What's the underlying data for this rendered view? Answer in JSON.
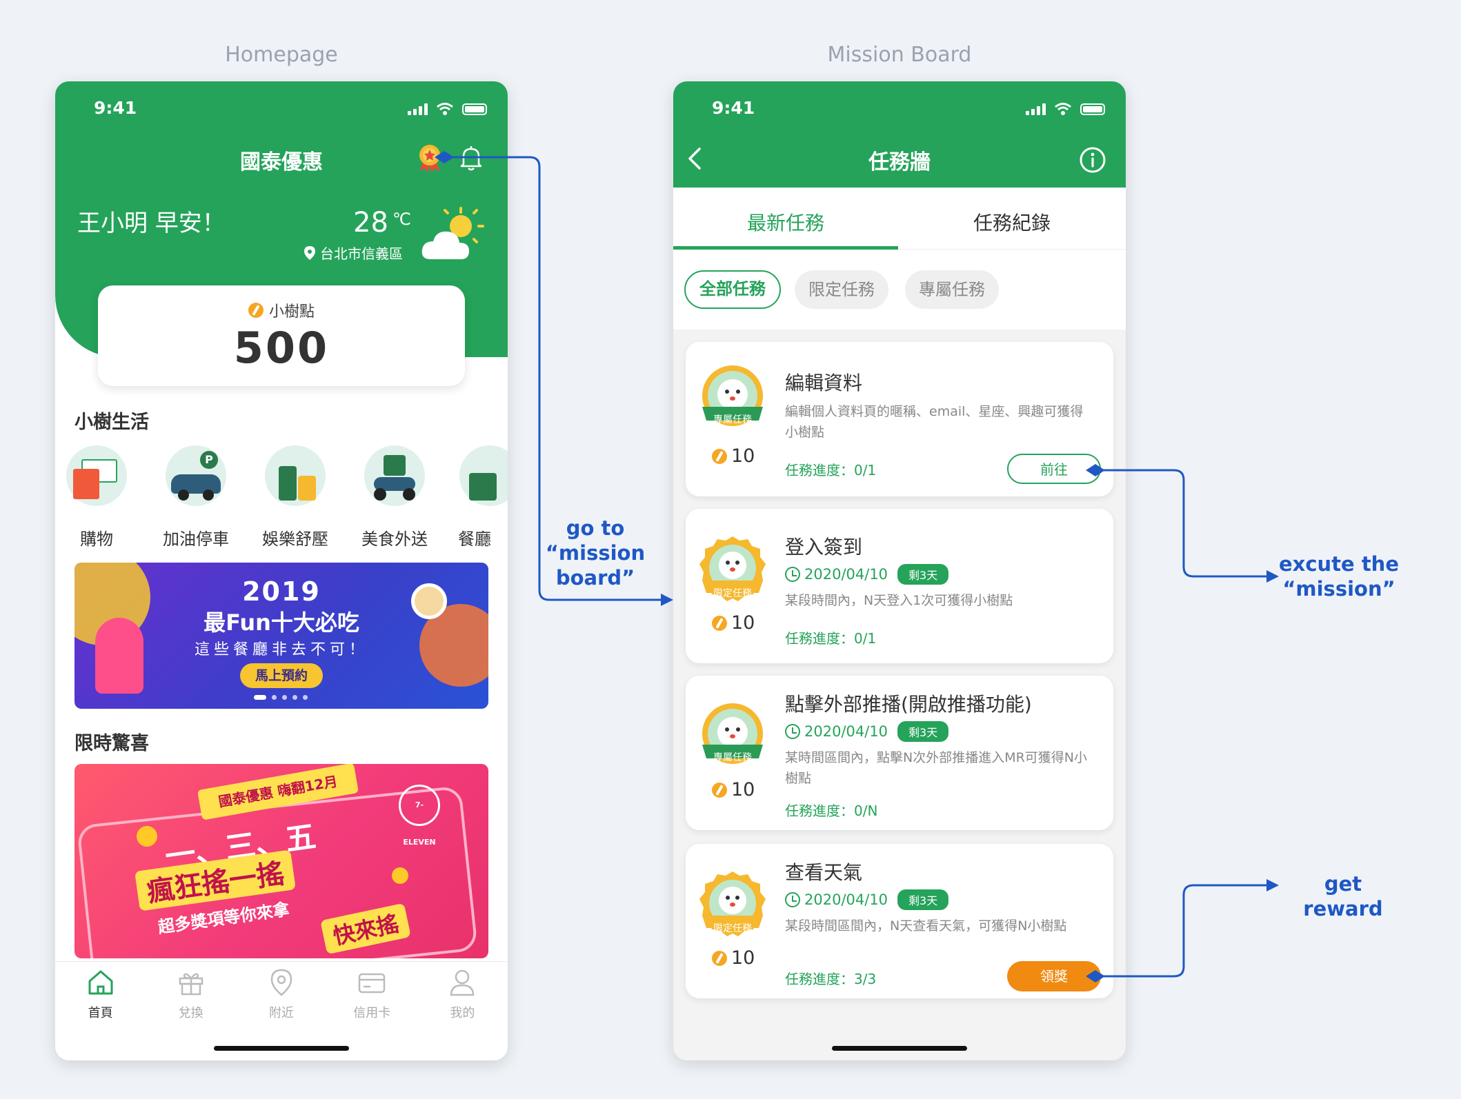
{
  "labels": {
    "homepage": "Homepage",
    "mission_board": "Mission Board"
  },
  "annotations": {
    "go_to_board": [
      "go to",
      "“mission",
      "board”"
    ],
    "execute": [
      "excute the",
      "“mission”"
    ],
    "reward": "get reward"
  },
  "colors": {
    "brand_green": "#25a35a",
    "annotation_blue": "#1f58c4",
    "reward_orange": "#f08a10"
  },
  "home": {
    "time": "9:41",
    "title": "國泰優惠",
    "greeting": "王小明 早安！",
    "temperature": "28",
    "temp_unit": "℃",
    "location": "台北市信義區",
    "points_label": "小樹點",
    "points": "500",
    "section_life": "小樹生活",
    "categories": [
      "購物",
      "加油停車",
      "娛樂舒壓",
      "美食外送",
      "餐廳"
    ],
    "banner1": {
      "year": "2019",
      "headline": "最Fun十大必吃",
      "sub": "這些餐廳非去不可！",
      "cta": "馬上預約"
    },
    "section_surprise": "限時驚喜",
    "banner2": {
      "tag": "國泰優惠 嗨翻12月",
      "brand": "7-ELEVEN",
      "days": "一、三、五",
      "headline": "瘋狂搖一搖",
      "sub": "超多獎項等你來拿",
      "cta": "快來搖"
    },
    "tabs": [
      "首頁",
      "兌換",
      "附近",
      "信用卡",
      "我的"
    ]
  },
  "board": {
    "time": "9:41",
    "title": "任務牆",
    "tabs": [
      "最新任務",
      "任務紀錄"
    ],
    "filters": [
      "全部任務",
      "限定任務",
      "專屬任務"
    ],
    "missions": [
      {
        "badge": "專屬任務",
        "title": "編輯資料",
        "desc": "編輯個人資料頁的暱稱、email、星座、興趣可獲得小樹點",
        "points": "10",
        "progress": "任務進度：0/1",
        "action": "前往"
      },
      {
        "badge": "限定任務",
        "title": "登入簽到",
        "date": "2020/04/10",
        "remaining": "剩3天",
        "desc": "某段時間內，N天登入1次可獲得小樹點",
        "points": "10",
        "progress": "任務進度：0/1"
      },
      {
        "badge": "專屬任務",
        "title": "點擊外部推播(開啟推播功能)",
        "date": "2020/04/10",
        "remaining": "剩3天",
        "desc": "某時間區間內，點擊N次外部推播進入MR可獲得N小樹點",
        "points": "10",
        "progress": "任務進度：0/N"
      },
      {
        "badge": "限定任務",
        "title": "查看天氣",
        "date": "2020/04/10",
        "remaining": "剩3天",
        "desc": "某段時間區間內，N天查看天氣，可獲得N小樹點",
        "points": "10",
        "progress": "任務進度：3/3",
        "action": "領獎"
      }
    ]
  }
}
